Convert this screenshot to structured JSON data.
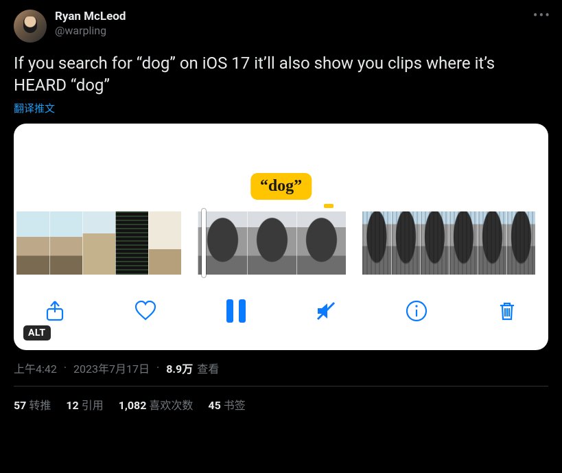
{
  "author": {
    "display_name": "Ryan McLeod",
    "handle": "@warpling"
  },
  "tweet_text": "If you search for “dog” on iOS 17 it’ll also show you clips where it’s HEARD “dog”",
  "translate_label": "翻译推文",
  "media": {
    "pill_text": "“dog”",
    "alt_badge": "ALT",
    "toolbar": {
      "share": "share",
      "like": "like",
      "pause": "pause",
      "mute": "mute",
      "info": "info",
      "delete": "delete"
    }
  },
  "meta": {
    "time": "上午4:42",
    "date": "2023年7月17日",
    "views_count": "8.9万",
    "views_label": "查看"
  },
  "stats": {
    "retweets_n": "57",
    "retweets_label": "转推",
    "quotes_n": "12",
    "quotes_label": "引用",
    "likes_n": "1,082",
    "likes_label": "喜欢次数",
    "bookmarks_n": "45",
    "bookmarks_label": "书签"
  },
  "more_label": "•••"
}
